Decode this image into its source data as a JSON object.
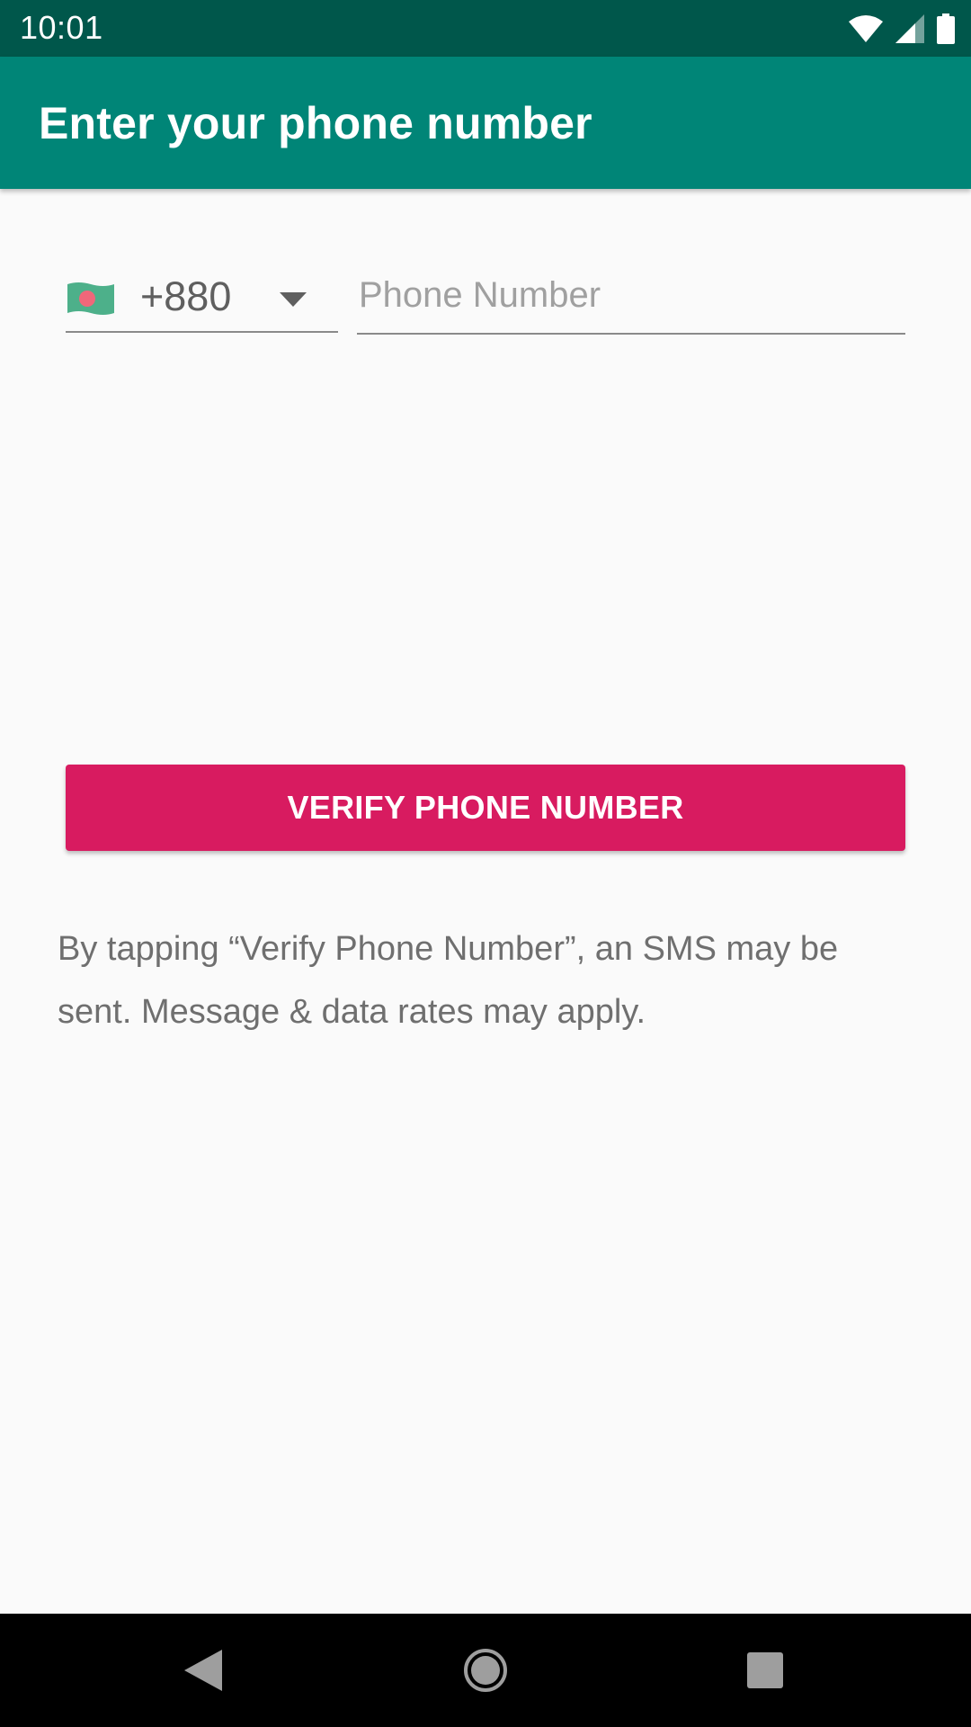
{
  "status_bar": {
    "time": "10:01",
    "icons": [
      "wifi-icon",
      "signal-icon",
      "battery-icon"
    ]
  },
  "app_bar": {
    "title": "Enter your phone number"
  },
  "country_picker": {
    "flag": "bangladesh-flag-icon",
    "code": "+880"
  },
  "phone_input": {
    "value": "",
    "placeholder": "Phone Number"
  },
  "verify_button": {
    "label": "VERIFY PHONE NUMBER"
  },
  "disclaimer": {
    "text": "By tapping “Verify Phone Number”, an SMS may be sent. Message & data rates may apply."
  },
  "nav_bar": {
    "buttons": [
      "back-icon",
      "home-icon",
      "recents-icon"
    ]
  },
  "colors": {
    "status_bar": "#00574b",
    "app_bar": "#008577",
    "accent": "#d81b60",
    "background": "#fafafa",
    "flag_green": "#4db08a",
    "flag_red": "#f0677a"
  }
}
